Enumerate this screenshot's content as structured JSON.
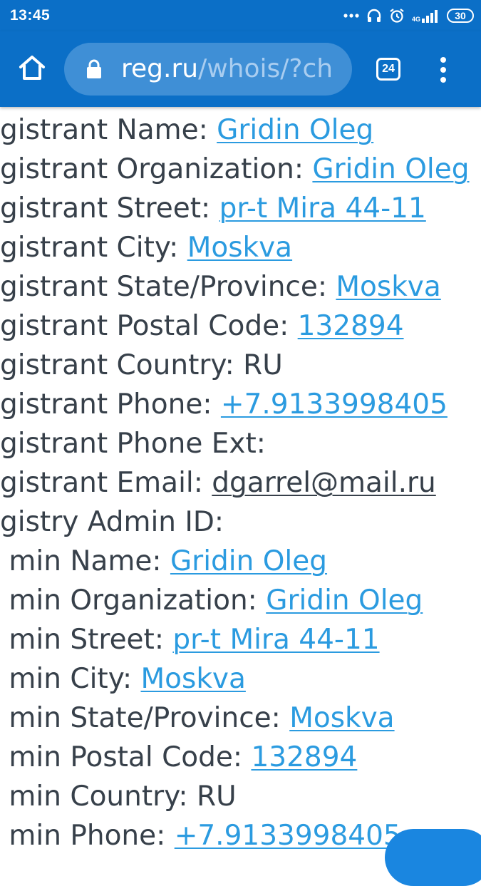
{
  "status_bar": {
    "time": "13:45",
    "network": "4G",
    "battery": "30"
  },
  "browser": {
    "url_host": "reg.ru",
    "url_path": "/whois/?ch",
    "tab_count": "24"
  },
  "whois": {
    "lines": [
      {
        "label": "gistrant Name: ",
        "value": "Gridin Oleg",
        "link": true
      },
      {
        "label": "gistrant Organization: ",
        "value": "Gridin Oleg",
        "link": true
      },
      {
        "label": "gistrant Street: ",
        "value": "pr-t Mira 44-11",
        "link": true
      },
      {
        "label": "gistrant City: ",
        "value": "Moskva",
        "link": true
      },
      {
        "label": "gistrant State/Province: ",
        "value": "Moskva",
        "link": true
      },
      {
        "label": "gistrant Postal Code: ",
        "value": "132894",
        "link": true
      },
      {
        "label": "gistrant Country: RU",
        "value": "",
        "link": false
      },
      {
        "label": "gistrant Phone: ",
        "value": "+7.9133998405",
        "link": true
      },
      {
        "label": "gistrant Phone Ext:",
        "value": "",
        "link": false
      },
      {
        "label": "gistrant Email: ",
        "value": "dgarrel@mail.ru",
        "link": true,
        "dark": true
      },
      {
        "label": "gistry Admin ID:",
        "value": "",
        "link": false
      },
      {
        "label": " min Name: ",
        "value": "Gridin Oleg",
        "link": true
      },
      {
        "label": " min Organization: ",
        "value": "Gridin Oleg",
        "link": true
      },
      {
        "label": " min Street: ",
        "value": "pr-t Mira 44-11",
        "link": true
      },
      {
        "label": " min City: ",
        "value": "Moskva",
        "link": true
      },
      {
        "label": " min State/Province: ",
        "value": "Moskva",
        "link": true
      },
      {
        "label": " min Postal Code: ",
        "value": "132894",
        "link": true
      },
      {
        "label": " min Country: RU",
        "value": "",
        "link": false
      },
      {
        "label": " min Phone: ",
        "value": "+7.9133998405",
        "link": true
      }
    ]
  },
  "colors": {
    "toolbar": "#0b6fc7",
    "link": "#2b9be0",
    "text": "#37404a"
  }
}
